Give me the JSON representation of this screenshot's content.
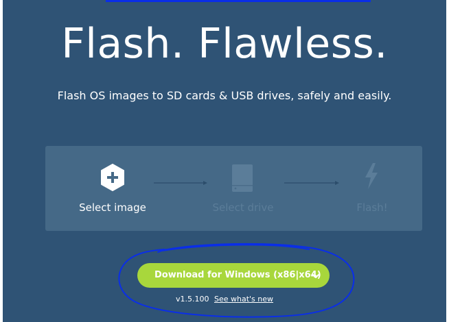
{
  "hero": {
    "title": "Flash. Flawless.",
    "subtitle": "Flash OS images to SD cards & USB drives, safely and easily."
  },
  "steps": [
    {
      "label": "Select image",
      "icon": "plus-hexagon-icon",
      "state": "active"
    },
    {
      "label": "Select drive",
      "icon": "drive-icon",
      "state": "inactive"
    },
    {
      "label": "Flash!",
      "icon": "lightning-icon",
      "state": "inactive"
    }
  ],
  "download": {
    "label": "Download for Windows (x86|x64)",
    "dropdown_icon": "chevron-down-icon"
  },
  "release": {
    "version": "v1.5.100",
    "whats_new": "See what's new"
  },
  "colors": {
    "background": "#2f5375",
    "panel": "#456987",
    "button": "#a8d73c",
    "inactive": "#5b7d99",
    "annotation": "#0a2ee8"
  }
}
